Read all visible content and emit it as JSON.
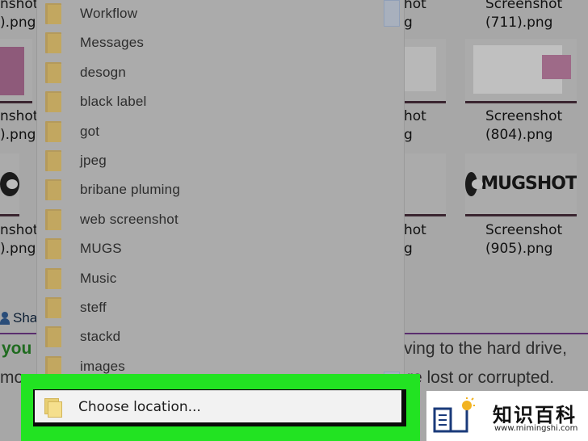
{
  "background": {
    "files": [
      {
        "line1": "nshot",
        "line2": ").png"
      },
      {
        "line1": "hot",
        "line2": "g"
      },
      {
        "line1": "Screenshot",
        "line2": "(711).png"
      },
      {
        "line1": "nshot",
        "line2": ").png"
      },
      {
        "line1": "hot",
        "line2": "g"
      },
      {
        "line1": "Screenshot",
        "line2": "(804).png"
      },
      {
        "line1": "nshot",
        "line2": ").png"
      },
      {
        "line1": "hot",
        "line2": "g"
      },
      {
        "line1": "Screenshot",
        "line2": "(905).png"
      }
    ],
    "mug_text": "MUGSHOT",
    "share_label": "Sha",
    "article_line1_left": "you",
    "article_line1_right": "ving to the hard drive,",
    "article_line2_left": "mo",
    "article_line2_right": "re lost or corrupted."
  },
  "dropdown": {
    "folders": [
      "Workflow",
      "Messages",
      "desogn",
      "black label",
      "got",
      "jpeg",
      "bribane pluming",
      "web screenshot",
      "MUGS",
      "Music",
      "steff",
      "stackd",
      "images"
    ],
    "choose_location_label": "Choose location..."
  },
  "watermark": {
    "chinese": "知识百科",
    "url": "www.mimingshi.com"
  },
  "colors": {
    "highlight": "#22e322",
    "folder": "#c2a760",
    "overlay": "#ababab"
  }
}
